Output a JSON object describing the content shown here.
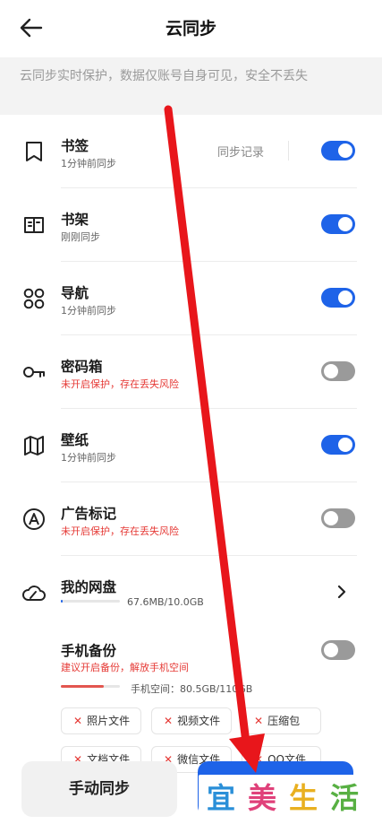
{
  "header": {
    "title": "云同步"
  },
  "notice": "云同步实时保护，数据仅账号自身可见，安全不丢失",
  "items": [
    {
      "label": "书签",
      "sub": "1分钟前同步",
      "warn": false,
      "on": true,
      "icon": "bookmark-icon"
    },
    {
      "label": "书架",
      "sub": "刚刚同步",
      "warn": false,
      "on": true,
      "icon": "bookshelf-icon"
    },
    {
      "label": "导航",
      "sub": "1分钟前同步",
      "warn": false,
      "on": true,
      "icon": "grid-icon"
    },
    {
      "label": "密码箱",
      "sub": "未开启保护，存在丢失风险",
      "warn": true,
      "on": false,
      "icon": "key-icon"
    },
    {
      "label": "壁纸",
      "sub": "1分钟前同步",
      "warn": false,
      "on": true,
      "icon": "map-icon"
    },
    {
      "label": "广告标记",
      "sub": "未开启保护，存在丢失风险",
      "warn": true,
      "on": false,
      "icon": "ad-mark-icon"
    }
  ],
  "sync_record": "同步记录",
  "cloud_disk": {
    "label": "我的网盘",
    "usage": "67.6MB/10.0GB",
    "usage_fraction": 0.007
  },
  "phone_backup": {
    "label": "手机备份",
    "sub": "建议开启备份，解放手机空间",
    "on": false,
    "space": "手机空间：80.5GB/11",
    "space_tail": "0GB",
    "usage_fraction": 0.73
  },
  "backup_chips": [
    "照片文件",
    "视频文件",
    "压缩包",
    "文档文件",
    "微信文件",
    "QQ文件"
  ],
  "buttons": {
    "manual_sync": "手动同步"
  },
  "watermark": [
    "宜",
    "美",
    "生",
    "活"
  ],
  "colors": {
    "accent": "#1e63e8",
    "warning": "#e53935",
    "arrow": "#e8161b"
  }
}
